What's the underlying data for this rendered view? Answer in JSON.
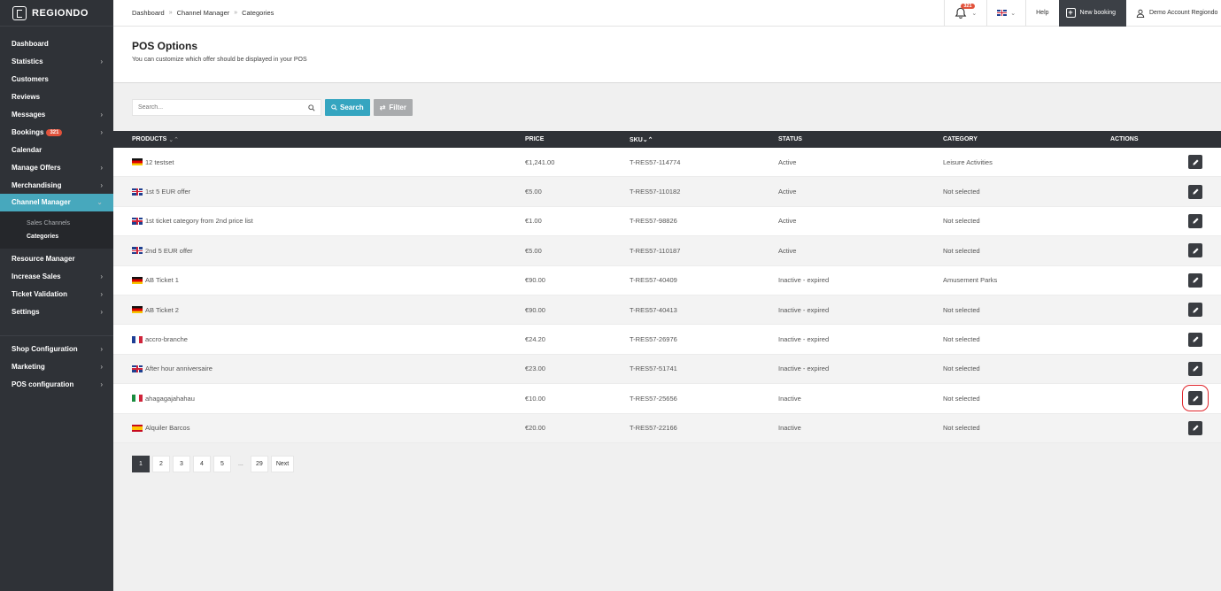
{
  "brand": {
    "name": "REGIONDO"
  },
  "sidebar": {
    "items": [
      {
        "label": "Dashboard",
        "chevron": false
      },
      {
        "label": "Statistics",
        "chevron": true
      },
      {
        "label": "Customers",
        "chevron": false
      },
      {
        "label": "Reviews",
        "chevron": false
      },
      {
        "label": "Messages",
        "chevron": true
      },
      {
        "label": "Bookings",
        "chevron": true,
        "badge": "321"
      },
      {
        "label": "Calendar",
        "chevron": false
      },
      {
        "label": "Manage Offers",
        "chevron": true
      },
      {
        "label": "Merchandising",
        "chevron": true
      },
      {
        "label": "Channel Manager",
        "chevron": true,
        "active": true
      }
    ],
    "channel_manager_sub": [
      {
        "label": "Sales Channels"
      },
      {
        "label": "Categories",
        "current": true
      }
    ],
    "items_after": [
      {
        "label": "Resource Manager",
        "chevron": false
      },
      {
        "label": "Increase Sales",
        "chevron": true
      },
      {
        "label": "Ticket Validation",
        "chevron": true
      },
      {
        "label": "Settings",
        "chevron": true
      }
    ],
    "items_bottom": [
      {
        "label": "Shop Configuration",
        "chevron": true
      },
      {
        "label": "Marketing",
        "chevron": true
      },
      {
        "label": "POS configuration",
        "chevron": true
      }
    ],
    "chevron_glyph": "›",
    "chevron_down_glyph": "⌄"
  },
  "topbar": {
    "breadcrumb": [
      "Dashboard",
      "Channel Manager",
      "Categories"
    ],
    "breadcrumb_sep": "»",
    "notifications_count": "321",
    "help": "Help",
    "new_booking": "New booking",
    "account": "Demo Account Regiondo"
  },
  "page": {
    "title": "POS Options",
    "subtitle": "You can customize which offer should be displayed in your POS"
  },
  "search": {
    "placeholder": "Search...",
    "search_label": "Search",
    "filter_label": "Filter"
  },
  "table": {
    "headers": {
      "products": "PRODUCTS",
      "price": "PRICE",
      "sku": "SKU",
      "status": "STATUS",
      "category": "CATEGORY",
      "actions": "ACTIONS"
    },
    "sort_glyph": "⌄⌃",
    "rows": [
      {
        "flag": "de",
        "product": "12 testset",
        "price": "€1,241.00",
        "sku": "T-RES57-114774",
        "status": "Active",
        "category": "Leisure Activities"
      },
      {
        "flag": "gb",
        "product": "1st 5 EUR offer",
        "price": "€5.00",
        "sku": "T-RES57-110182",
        "status": "Active",
        "category": "Not selected"
      },
      {
        "flag": "gb",
        "product": "1st ticket category from 2nd price list",
        "price": "€1.00",
        "sku": "T-RES57-98826",
        "status": "Active",
        "category": "Not selected"
      },
      {
        "flag": "gb",
        "product": "2nd 5 EUR offer",
        "price": "€5.00",
        "sku": "T-RES57-110187",
        "status": "Active",
        "category": "Not selected"
      },
      {
        "flag": "de",
        "product": "AB Ticket 1",
        "price": "€90.00",
        "sku": "T-RES57-40409",
        "status": "Inactive - expired",
        "category": "Amusement Parks"
      },
      {
        "flag": "de",
        "product": "AB Ticket 2",
        "price": "€90.00",
        "sku": "T-RES57-40413",
        "status": "Inactive - expired",
        "category": "Not selected"
      },
      {
        "flag": "fr",
        "product": "accro-branche",
        "price": "€24.20",
        "sku": "T-RES57-26976",
        "status": "Inactive - expired",
        "category": "Not selected"
      },
      {
        "flag": "gb",
        "product": "After hour anniversaire",
        "price": "€23.00",
        "sku": "T-RES57-51741",
        "status": "Inactive - expired",
        "category": "Not selected"
      },
      {
        "flag": "it",
        "product": "ahagagajahahau",
        "price": "€10.00",
        "sku": "T-RES57-25656",
        "status": "Inactive",
        "category": "Not selected",
        "highlight": true
      },
      {
        "flag": "es",
        "product": "Alquiler Barcos",
        "price": "€20.00",
        "sku": "T-RES57-22166",
        "status": "Inactive",
        "category": "Not selected"
      }
    ]
  },
  "pagination": {
    "pages": [
      "1",
      "2",
      "3",
      "4",
      "5",
      "...",
      "29",
      "Next"
    ],
    "current": "1"
  },
  "colors": {
    "sidebar_bg": "#2f3237",
    "active_nav": "#47a8bd",
    "search_button": "#35a5c0",
    "filter_button": "#a9abad",
    "highlight_outline": "#e0262c"
  }
}
